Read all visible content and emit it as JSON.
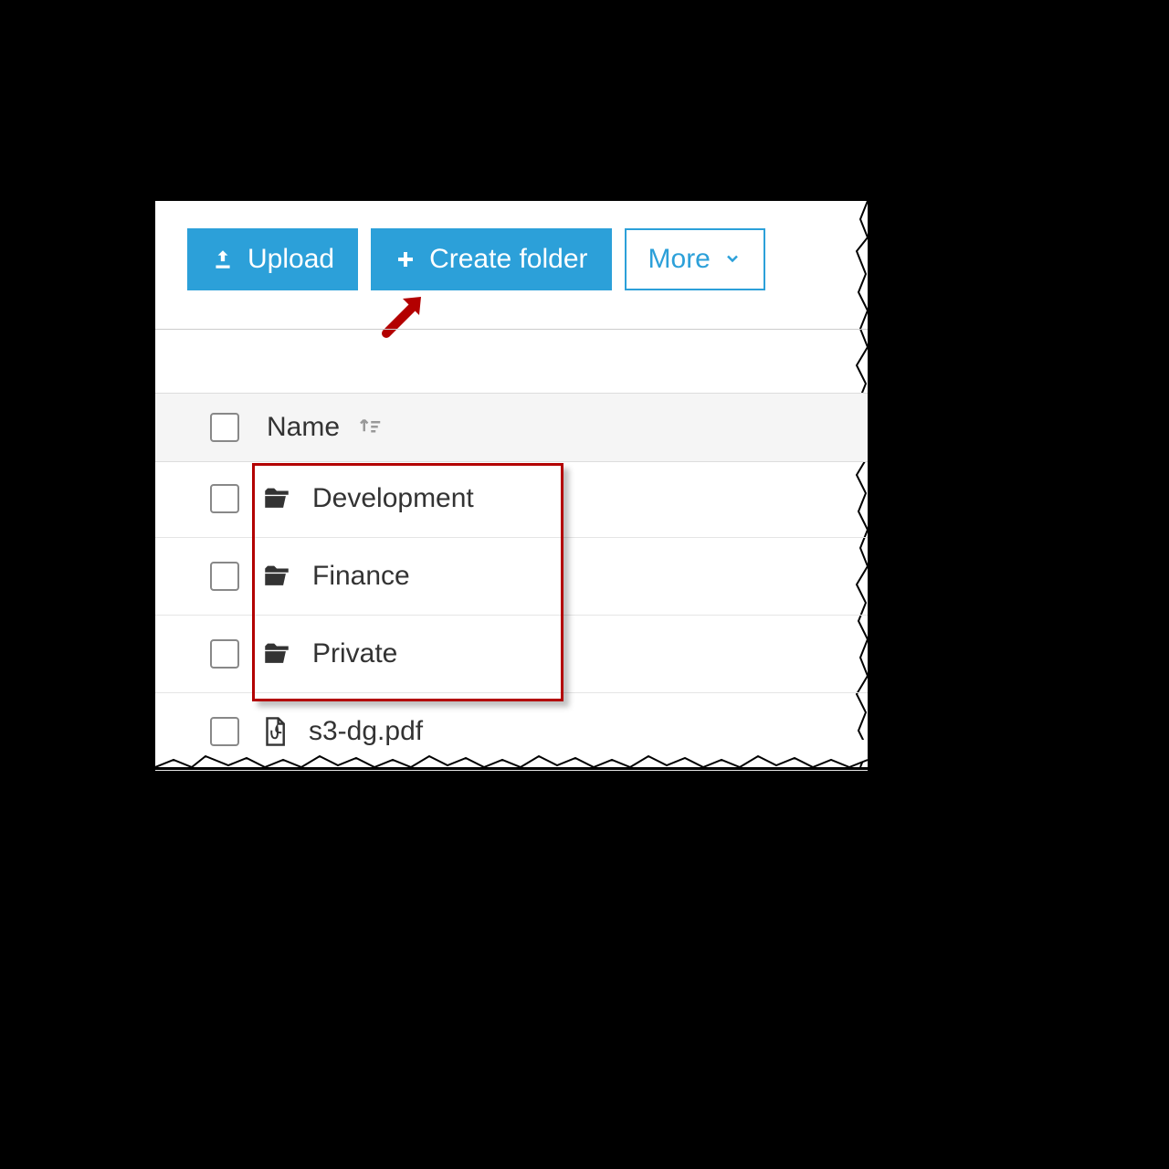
{
  "toolbar": {
    "upload_label": "Upload",
    "create_folder_label": "Create folder",
    "more_label": "More"
  },
  "table": {
    "header_name": "Name",
    "items": [
      {
        "type": "folder",
        "name": "Development"
      },
      {
        "type": "folder",
        "name": "Finance"
      },
      {
        "type": "folder",
        "name": "Private"
      },
      {
        "type": "pdf",
        "name": "s3-dg.pdf"
      }
    ]
  },
  "annotation": {
    "arrow_target": "create-folder-button",
    "highlight_box": "folders"
  },
  "colors": {
    "primary": "#2ca0d9",
    "highlight_border": "#b30000"
  }
}
